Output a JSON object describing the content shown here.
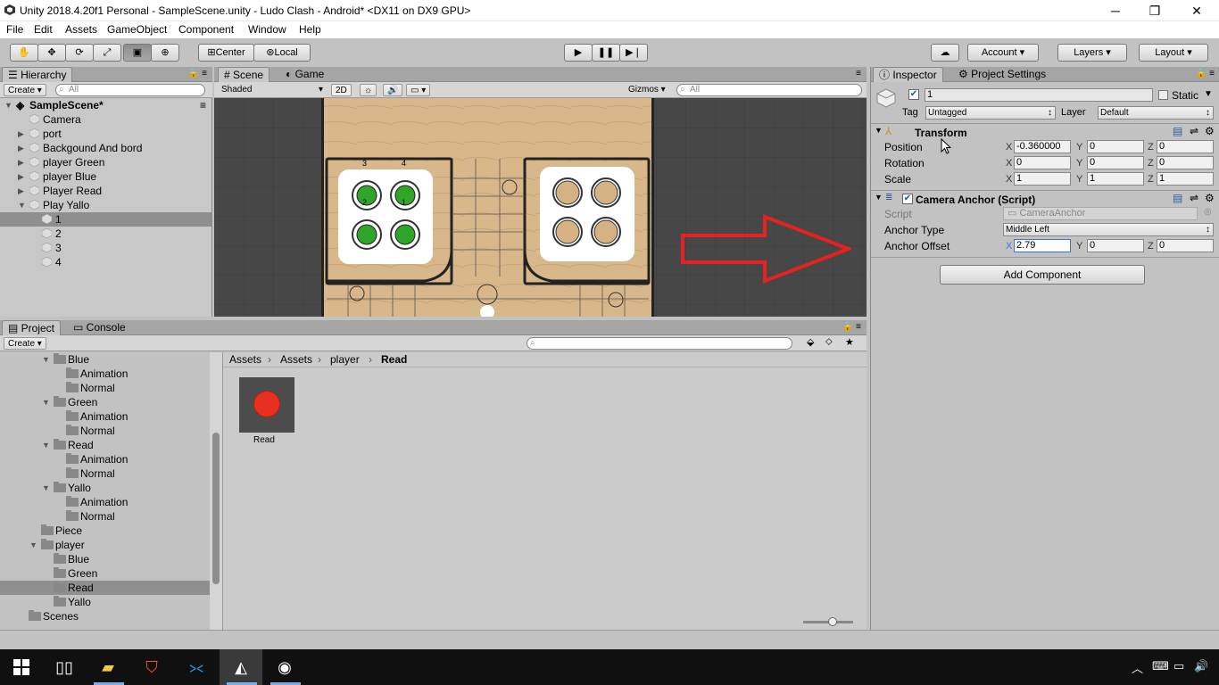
{
  "window": {
    "title": "Unity 2018.4.20f1 Personal - SampleScene.unity - Ludo Clash - Android* <DX11 on DX9 GPU>",
    "minimize": "─",
    "maximize": "❐",
    "close": "✕"
  },
  "menu": [
    "File",
    "Edit",
    "Assets",
    "GameObject",
    "Component",
    "Window",
    "Help"
  ],
  "toolbar": {
    "center": "Center",
    "local": "Local",
    "account": "Account",
    "layers": "Layers",
    "layout": "Layout"
  },
  "hierarchy": {
    "tab": "Hierarchy",
    "create": "Create",
    "search": "All",
    "scene": "SampleScene*",
    "items": [
      "Camera",
      "port",
      "Backgound And bord",
      "player Green",
      "player Blue",
      "Player Read",
      "Play Yallo",
      "1",
      "2",
      "3",
      "4"
    ]
  },
  "scene": {
    "tab_scene": "Scene",
    "tab_game": "Game",
    "shading": "Shaded",
    "mode2d": "2D",
    "gizmos": "Gizmos",
    "search": "All",
    "tokens": [
      "3",
      "4",
      "2",
      "1"
    ]
  },
  "project": {
    "tab": "Project",
    "console_tab": "Console",
    "create": "Create",
    "tree": [
      "Blue",
      "Animation",
      "Normal",
      "Green",
      "Animation",
      "Normal",
      "Read",
      "Animation",
      "Normal",
      "Yallo",
      "Animation",
      "Normal",
      "Piece",
      "player",
      "Blue",
      "Green",
      "Read",
      "Yallo",
      "Scenes"
    ],
    "breadcrumb": [
      "Assets",
      "Assets",
      "player",
      "Read"
    ],
    "asset_label": "Read"
  },
  "inspector": {
    "tab": "Inspector",
    "settings_tab": "Project Settings",
    "object_name": "1",
    "static": "Static",
    "tag_label": "Tag",
    "tag": "Untagged",
    "layer_label": "Layer",
    "layer": "Default",
    "transform": {
      "title": "Transform",
      "position": "Position",
      "rotation": "Rotation",
      "scale": "Scale",
      "pos": [
        "-0.360000",
        "0",
        "0"
      ],
      "rot": [
        "0",
        "0",
        "0"
      ],
      "scl": [
        "1",
        "1",
        "1"
      ]
    },
    "script_comp": {
      "title": "Camera Anchor (Script)",
      "script_label": "Script",
      "script": "CameraAnchor",
      "anchor_type_label": "Anchor Type",
      "anchor_type": "Middle Left",
      "anchor_offset_label": "Anchor Offset",
      "offset": [
        "2.79",
        "0",
        "0"
      ]
    },
    "add_component": "Add Component"
  },
  "colors": {
    "accent": "#3a72d8",
    "red_arrow": "#e8201f",
    "token_green": "#2fa52a",
    "asset_red": "#e83020"
  }
}
